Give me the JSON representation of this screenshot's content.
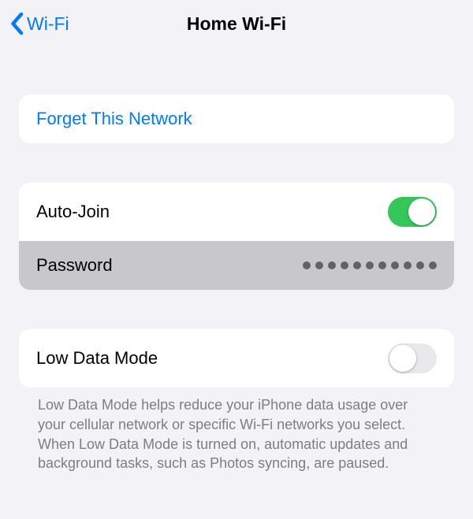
{
  "nav": {
    "back_label": "Wi-Fi",
    "title": "Home Wi-Fi"
  },
  "forget": {
    "label": "Forget This Network"
  },
  "settings": {
    "autojoin_label": "Auto-Join",
    "autojoin_on": true,
    "password_label": "Password",
    "password_dot_count": 11
  },
  "lowdata": {
    "label": "Low Data Mode",
    "on": false,
    "help": "Low Data Mode helps reduce your iPhone data usage over your cellular network or specific Wi-Fi networks you select. When Low Data Mode is turned on, automatic updates and background tasks, such as Photos syncing, are paused."
  }
}
